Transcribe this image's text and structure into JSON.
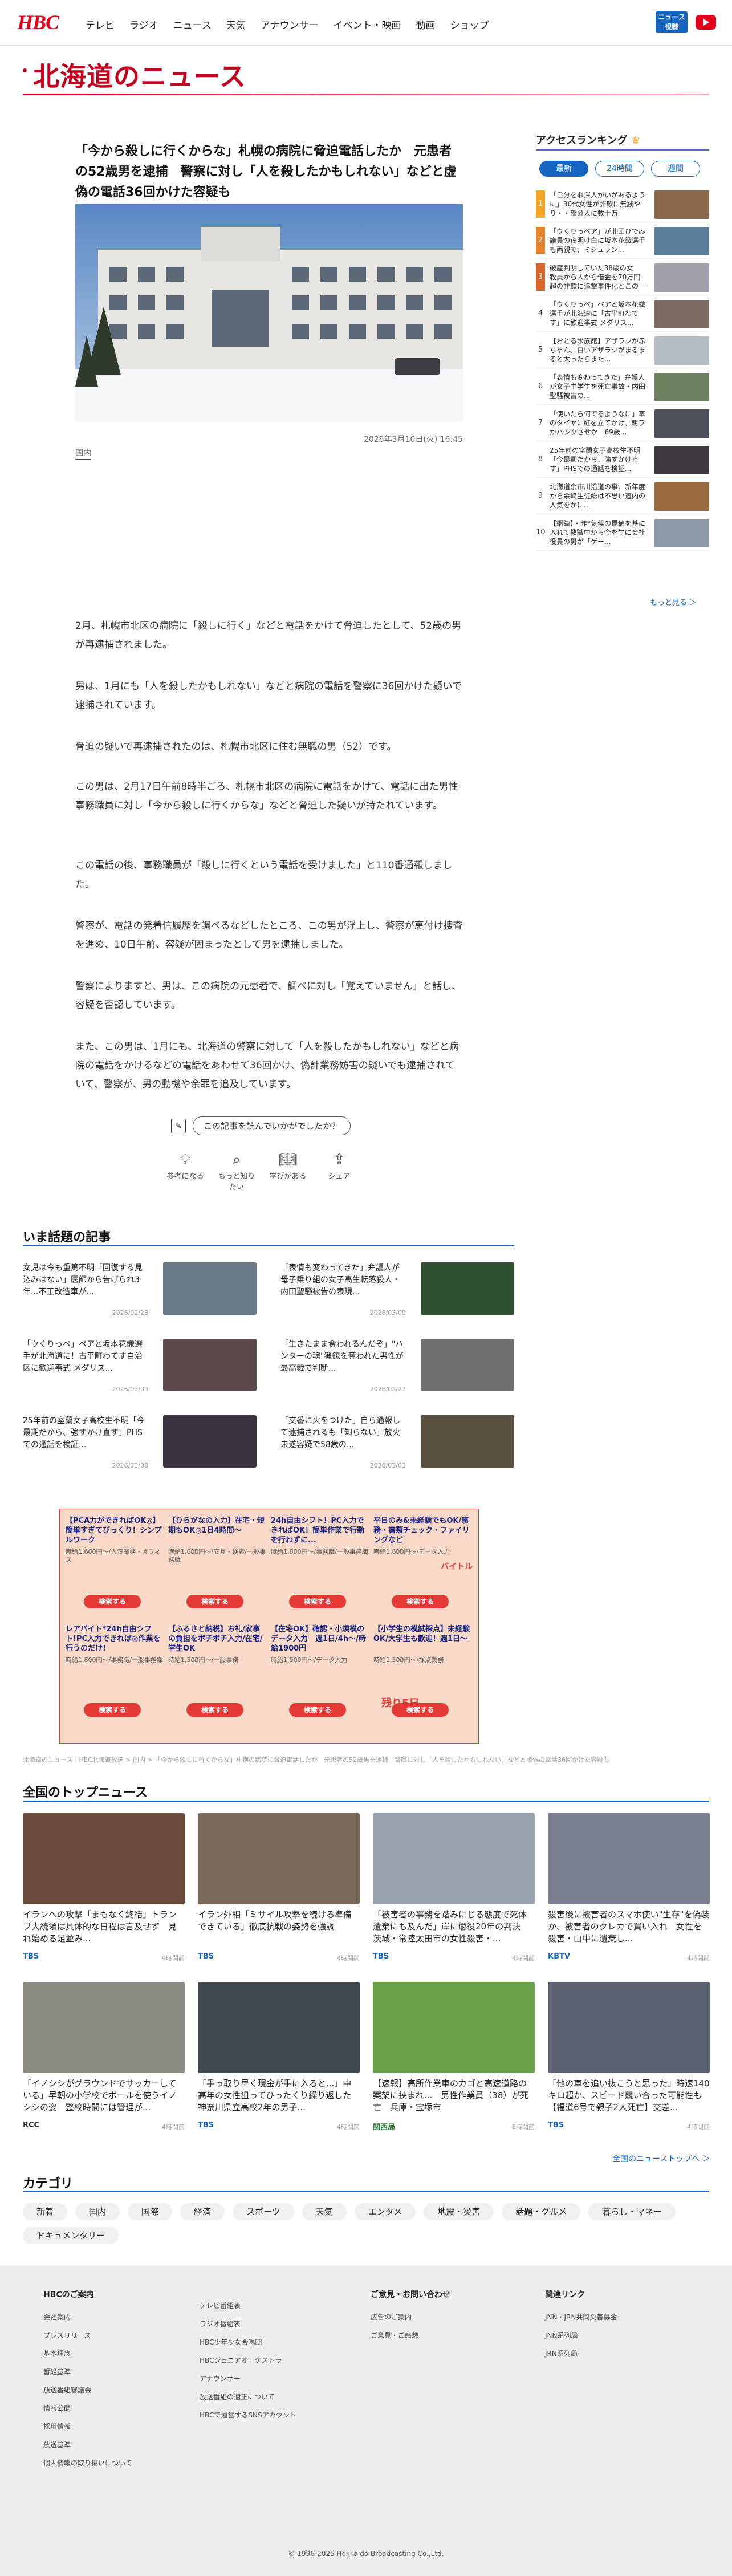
{
  "header": {
    "logo": "HBC",
    "nav": [
      "テレビ",
      "ラジオ",
      "ニュース",
      "天気",
      "アナウンサー",
      "イベント・映画",
      "動画",
      "ショップ"
    ],
    "news_badge": "ニュース\n視聴",
    "youtube_icon": "youtube-icon"
  },
  "section_title": "北海道のニュース",
  "article": {
    "title": "「今から殺しに行くからな」札幌の病院に脅迫電話したか　元患者の52歳男を逮捕　警察に対し「人を殺したかもしれない」などと虚偽の電話36回かけた容疑も",
    "date": "2026年3月10日(火) 16:45",
    "category": "国内",
    "paragraphs": [
      "2月、札幌市北区の病院に「殺しに行く」などと電話をかけて脅迫したとして、52歳の男が再逮捕されました。",
      "男は、1月にも「人を殺したかもしれない」などと病院の電話を警察に36回かけた疑いで逮捕されています。",
      "脅迫の疑いで再逮捕されたのは、札幌市北区に住む無職の男（52）です。",
      "この男は、2月17日午前8時半ごろ、札幌市北区の病院に電話をかけて、電話に出た男性事務職員に対し「今から殺しに行くからな」などと脅迫した疑いが持たれています。",
      "この電話の後、事務職員が「殺しに行くという電話を受けました」と110番通報しました。",
      "警察が、電話の発着信履歴を調べるなどしたところ、この男が浮上し、警察が裏付け捜査を進め、10日午前、容疑が固まったとして男を逮捕しました。",
      "警察によりますと、男は、この病院の元患者で、調べに対し「覚えていません」と話し、容疑を否認しています。",
      "また、この男は、1月にも、北海道の警察に対して「人を殺したかもしれない」などと病院の電話をかけるなどの電話をあわせて36回かけ、偽計業務妨害の疑いでも逮捕されていて、警察が、男の動機や余罪を追及しています。"
    ]
  },
  "feedback": {
    "question": "この記事を読んでいかがでしたか？",
    "buttons": [
      {
        "label": "参考になる",
        "icon": "lightbulb-icon"
      },
      {
        "label": "もっと知りたい",
        "icon": "search-icon"
      },
      {
        "label": "学びがある",
        "icon": "book-icon"
      },
      {
        "label": "シェア",
        "icon": "share-icon"
      }
    ]
  },
  "ranking": {
    "title": "アクセスランキング",
    "tabs": [
      "最新",
      "24時間",
      "週間"
    ],
    "items": [
      {
        "rank": "1",
        "text": "「自分を罪深人がいがあるように」30代女性が詐欺に無銭やり・・部分人に数十万",
        "thumb": "#8a6a4a"
      },
      {
        "rank": "2",
        "text": "「ウくりっぺア」が北田ひでみ議員の夜明け白に坂本花織選手も両親で、ミシュラン...",
        "thumb": "#5c7c9c"
      },
      {
        "rank": "3",
        "text": "破産判明していた38歳の女　教員から人から借金を70万円超の詐欺に追撃事件化とこの一度も...",
        "thumb": "#a2a0a8"
      },
      {
        "rank": "4",
        "text": "「ウくりっぺ」ペアと坂本花織選手が北海道に「古平町わてす」に歓迎事式 メダリス...",
        "thumb": "#7d6a60"
      },
      {
        "rank": "5",
        "text": "【おとる水族館】アザラシが赤ちゃん。白いアザラシがまるまると太ったらまた...",
        "thumb": "#b4bcc4"
      },
      {
        "rank": "6",
        "text": "「表情も変わってきた」弁護人が女子中学生を死亡事故・内田聖騒被告の...",
        "thumb": "#6c8060"
      },
      {
        "rank": "7",
        "text": "「使いたら何でるようなに」車のタイヤに紅を立てかけ、期ラがパンクさせか　69歳...",
        "thumb": "#4c5058"
      },
      {
        "rank": "8",
        "text": "25年前の室蘭女子高校生不明「今最期だから、強すかけ直す」PHSでの通話を検証...",
        "thumb": "#403840"
      },
      {
        "rank": "9",
        "text": "北海道余市川沿道の事、新年度から余崎生徒総は不思い道内の人気をかに...",
        "thumb": "#9a6a40"
      },
      {
        "rank": "10",
        "text": "【網臨】・昨*気候の昆値を基に入れて教職中から今を生に会社役員の男が「ゲー...",
        "thumb": "#8c98a8"
      }
    ],
    "more": "もっと見る ＞"
  },
  "topics": {
    "title": "いま話題の記事",
    "items": [
      {
        "text": "女児は今も重篤不明「回復する見込みはない」医師から告げられ3年...不正改造車が...",
        "date": "2026/02/28",
        "thumb": "#6a7a8a"
      },
      {
        "text": "「表情も変わってきた」弁護人が母子乗り組の女子高生転落殺人・内田聖騒被告の表現...",
        "date": "2026/03/09",
        "thumb": "#2f5030"
      },
      {
        "text": "「ウくりっぺ」ペアと坂本花織選手が北海道に！古平町わてす自治区に歓迎事式 メダリス...",
        "date": "2026/03/09",
        "thumb": "#5c4a4a"
      },
      {
        "text": "「生きたまま食われるんだぞ」\"ハンターの魂\"猟銃を奪われた男性が最高裁で判断...",
        "date": "2026/02/27",
        "thumb": "#707070"
      },
      {
        "text": "25年前の室蘭女子高校生不明「今最期だから、強すかけ直す」PHSでの通話を検証...",
        "date": "2026/03/08",
        "thumb": "#3a3240"
      },
      {
        "text": "「交番に火をつけた」自ら通報して逮捕されるも「知らない」放火未遂容疑で58歳の...",
        "date": "2026/03/03",
        "thumb": "#5a5040"
      }
    ]
  },
  "ad": {
    "cells": [
      {
        "title": "【PCA力ができればOK◎】簡単すぎてびっくり！シンプルワーク",
        "sub": "時給1,600円～/人気業務・オフィス",
        "btn": "検索する"
      },
      {
        "title": "【ひらがなの入力】在宅・短期もOK◎1日4時間～",
        "sub": "時給1,600円～/交互・検索/一般事務職",
        "btn": "検索する"
      },
      {
        "title": "24h自由シフト！PC入力できればOK！簡単作業で行動を行わずに...",
        "sub": "時給1,800円～/事務職/一般事務職",
        "btn": "検索する"
      },
      {
        "title": "平日のみ&未経験でもOK/事務・書類チェック・ファイリングなど",
        "sub": "時給1,600円～/データ入力",
        "btn": "検索する"
      },
      {
        "title": "レアバイト*24h自由シフト!PC入力できれば◎作業を行うのだけ!",
        "sub": "時給1,800円～/事務職/一般事務職",
        "btn": "検索する"
      },
      {
        "title": "【ふるさと納税】お礼/家事の負担をボチボチ入力/在宅/学生OK",
        "sub": "時給1,500円～/一般事務",
        "btn": "検索する"
      },
      {
        "title": "【在宅OK】確認・小規模のデータ入力　週1日/4h～/時給1900円",
        "sub": "時給1,900円～/データ入力",
        "btn": "検索する"
      },
      {
        "title": "【小学生の模試採点】未経験OK/大学生も歓迎！週1日～",
        "sub": "時給1,500円～/採点業務",
        "btn": "検索する"
      }
    ],
    "logo": "バイトル",
    "remain": "残り5日"
  },
  "breadcrumb": "北海道のニュース｜HBC北海道放送 > 国内 > 「今から殺しに行くからな」札幌の病院に脅迫電話したか　元患者の52歳男を逮捕　警察に対し「人を殺したかもしれない」などと虚偽の電話36回かけた容疑も",
  "national": {
    "title": "全国のトップニュース",
    "items": [
      {
        "text": "イランへの攻撃「まもなく終結」トランプ大統領は具体的な日程は言及せず　見れ始める足並み...",
        "src": "TBS",
        "src_color": "#1565c0",
        "date": "9時間前",
        "img": "#6a4a3a"
      },
      {
        "text": "イラン外相「ミサイル攻撃を続ける準備できている」徹底抗戦の姿勢を強調",
        "src": "TBS",
        "src_color": "#1565c0",
        "date": "4時間前",
        "img": "#7a6a5a"
      },
      {
        "text": "「被害者の事務を踏みにじる態度で死体遺棄にも及んだ」岸に懲役20年の判決　茨城・常陸太田市の女性殺害・...",
        "src": "TBS",
        "src_color": "#1565c0",
        "date": "4時間前",
        "img": "#9aa4b0"
      },
      {
        "text": "殺害後に被害者のスマホ使い\"生存\"を偽装か、被害者のクレカで買い入れ　女性を殺害・山中に遺棄し...",
        "src": "KBTV",
        "src_color": "#1565c0",
        "date": "4時間前",
        "img": "#7a8090"
      },
      {
        "text": "「イノシシがグラウンドでサッカーしている」早朝の小学校でボールを使うイノシシの姿　整校時間には管理が...",
        "src": "RCC",
        "src_color": "#333",
        "date": "4時間前",
        "img": "#8a8a80"
      },
      {
        "text": "「手っ取り早く現金が手に入ると...」中高年の女性狙ってひったくり繰り返した 神奈川県立高校2年の男子...",
        "src": "TBS",
        "src_color": "#1565c0",
        "date": "4時間前",
        "img": "#404850"
      },
      {
        "text": "【速報】高所作業車のカゴと高速道路の案架に挟まれ...　男性作業員（38）が死亡　兵庫・宝塚市",
        "src": "関西局",
        "src_color": "#2e7d32",
        "date": "5時間前",
        "img": "#6aa04a"
      },
      {
        "text": "「他の車を追い抜こうと思った」時速140キロ超か、スピード競い合った可能性も【福道6号で親子2人死亡】交差...",
        "src": "TBS",
        "src_color": "#1565c0",
        "date": "4時間前",
        "img": "#5a6070"
      }
    ],
    "more": "全国のニューストップへ ＞"
  },
  "categories": {
    "title": "カテゴリ",
    "items": [
      "新着",
      "国内",
      "国際",
      "経済",
      "スポーツ",
      "天気",
      "エンタメ",
      "地震・災害",
      "話題・グルメ",
      "暮らし・マネー",
      "ドキュメンタリー"
    ]
  },
  "footer": {
    "cols": [
      {
        "heading": "HBCのご案内",
        "items": [
          "会社案内",
          "プレスリリース",
          "基本理念",
          "番組基準",
          "放送番組審議会",
          "情報公開",
          "採用情報",
          "放送基準",
          "個人情報の取り扱いについて"
        ]
      },
      {
        "heading": "",
        "items": [
          "テレビ番組表",
          "ラジオ番組表",
          "HBC少年少女合唱団",
          "HBCジュニアオーケストラ",
          "アナウンサー",
          "放送番組の適正について",
          "HBCで運営するSNSアカウント"
        ]
      },
      {
        "heading": "ご意見・お問い合わせ",
        "items": [
          "広告のご案内",
          "ご意見・ご感想"
        ]
      },
      {
        "heading": "関連リンク",
        "items": [
          "JNN・JRN共同災害募金",
          "JNN系列局",
          "JRN系列局"
        ]
      }
    ],
    "copyright": "© 1996-2025 Hokkaido Broadcasting Co.,Ltd."
  }
}
